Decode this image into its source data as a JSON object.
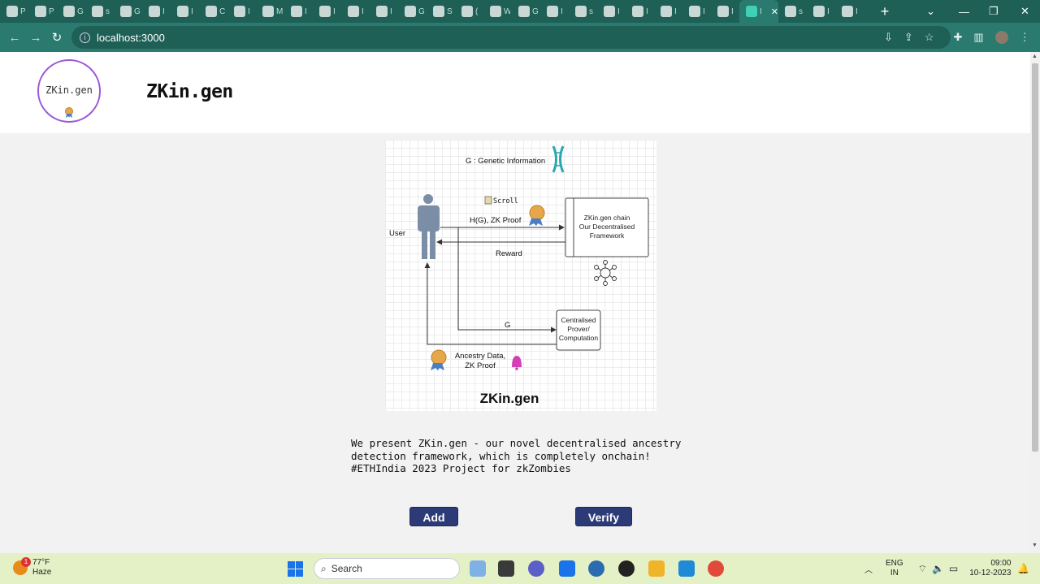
{
  "browser": {
    "tabs": [
      {
        "label": "P"
      },
      {
        "label": "P"
      },
      {
        "label": "G"
      },
      {
        "label": "s"
      },
      {
        "label": "G"
      },
      {
        "label": "I"
      },
      {
        "label": "I"
      },
      {
        "label": "C"
      },
      {
        "label": "I"
      },
      {
        "label": "M"
      },
      {
        "label": "I"
      },
      {
        "label": "I"
      },
      {
        "label": "I"
      },
      {
        "label": "I"
      },
      {
        "label": "G"
      },
      {
        "label": "S"
      },
      {
        "label": "("
      },
      {
        "label": "W"
      },
      {
        "label": "G"
      },
      {
        "label": "I"
      },
      {
        "label": "s"
      },
      {
        "label": "I"
      },
      {
        "label": "I"
      },
      {
        "label": "I"
      },
      {
        "label": "I"
      },
      {
        "label": "I"
      },
      {
        "label": "s"
      },
      {
        "label": "I"
      },
      {
        "label": "I"
      }
    ],
    "active_tab_label": "I",
    "url": "localhost:3000"
  },
  "page": {
    "logo_text": "ZKin.gen",
    "site_title": "ZKin.gen",
    "diagram": {
      "genetic_label": "G : Genetic Information",
      "scroll_label": "Scroll",
      "user_label": "User",
      "proof_label": "H(G),  ZK Proof",
      "reward_label": "Reward",
      "chain_line1": "ZKin.gen chain",
      "chain_line2": "Our Decentralised",
      "chain_line3": "Framework",
      "g_label": "G",
      "central_line1": "Centralised",
      "central_line2": "Prover/",
      "central_line3": "Computation",
      "ancestry_line1": "Ancestry Data,",
      "ancestry_line2": "ZK Proof",
      "title": "ZKin.gen"
    },
    "description": "We present ZKin.gen - our novel decentralised ancestry\ndetection framework, which is completely onchain!\n#ETHIndia 2023 Project for zkZombies",
    "add_button": "Add",
    "verify_button": "Verify"
  },
  "taskbar": {
    "weather_temp": "77°F",
    "weather_desc": "Haze",
    "weather_badge": "1",
    "search_placeholder": "Search",
    "lang1": "ENG",
    "lang2": "IN",
    "time": "09:00",
    "date": "10-12-2023"
  },
  "colors": {
    "chrome_frame": "#1e6056",
    "toolbar": "#2a7a6f",
    "button_bg": "#2c3a77",
    "logo_ring": "#9c58d6",
    "taskbar": "#e4f1c6"
  }
}
